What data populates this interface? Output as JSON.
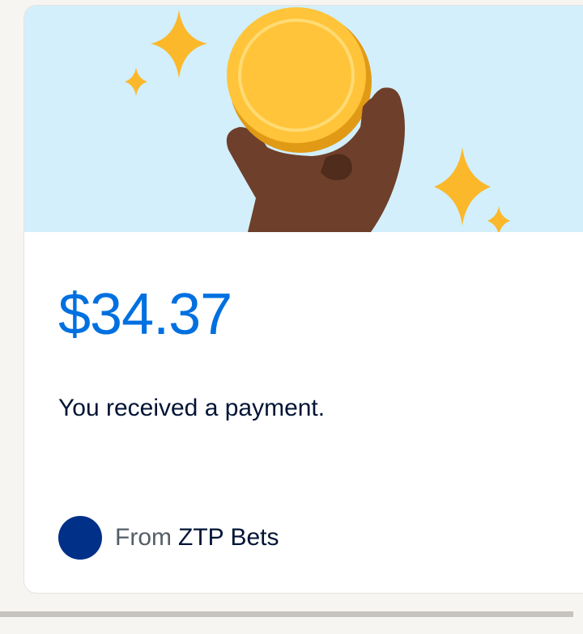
{
  "payment": {
    "amount": "$34.37",
    "message": "You received a payment.",
    "from_label": "From",
    "sender_name": "ZTP Bets"
  },
  "colors": {
    "amount": "#0070e0",
    "banner_bg": "#d2effb",
    "avatar": "#003087",
    "coin": "#ffc439",
    "sparkle": "#fbb82a",
    "hand": "#6e3f2a"
  },
  "icons": {
    "banner": "hand-holding-coin-illustration",
    "avatar": "sender-avatar"
  }
}
